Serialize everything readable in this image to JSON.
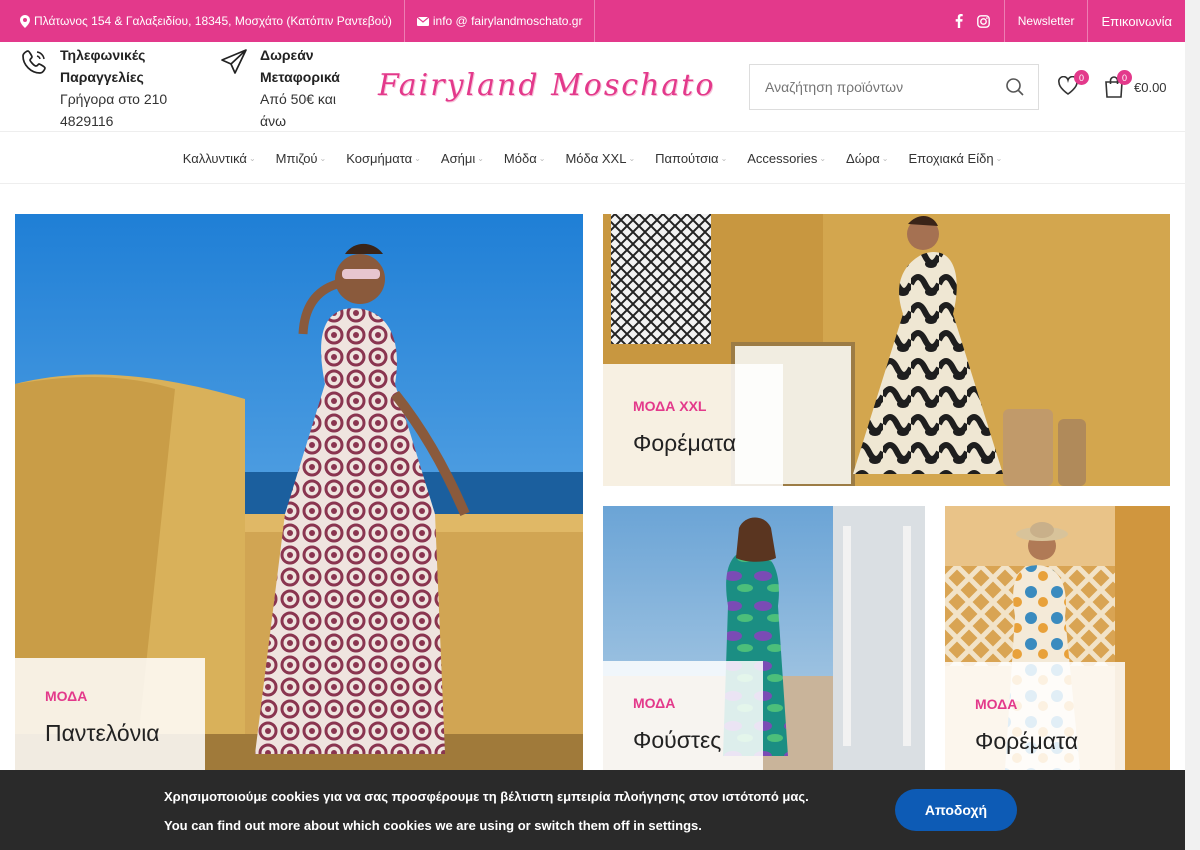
{
  "topbar": {
    "address": "Πλάτωνος 154 & Γαλαξειδίου, 18345, Μοσχάτο (Κατόπιν Ραντεβού)",
    "email": "info @ fairylandmoschato.gr",
    "newsletter": "Newsletter",
    "contact": "Επικοινωνία"
  },
  "header": {
    "phone_title_1": "Τηλεφωνικές",
    "phone_title_2": "Παραγγελίες",
    "phone_sub_1": "Γρήγορα στο 210",
    "phone_sub_2": "4829116",
    "ship_title_1": "Δωρεάν",
    "ship_title_2": "Μεταφορικά",
    "ship_sub_1": "Από 50€ και",
    "ship_sub_2": "άνω",
    "logo": "Fairyland Moschato",
    "search_placeholder": "Αναζήτηση προϊόντων",
    "wishlist_count": "0",
    "cart_count": "0",
    "cart_total": "€0.00"
  },
  "nav": {
    "items": [
      {
        "label": "Καλλυντικά"
      },
      {
        "label": "Μπιζού"
      },
      {
        "label": "Κοσμήματα"
      },
      {
        "label": "Ασήμι"
      },
      {
        "label": "Μόδα"
      },
      {
        "label": "Μόδα XXL"
      },
      {
        "label": "Παπούτσια"
      },
      {
        "label": "Accessories"
      },
      {
        "label": "Δώρα"
      },
      {
        "label": "Εποχιακά Είδη"
      }
    ]
  },
  "banners": [
    {
      "category": "ΜΟΔΑ",
      "title": "Παντελόνια"
    },
    {
      "category": "ΜΟΔΑ XXL",
      "title": "Φορέματα"
    },
    {
      "category": "ΜΟΔΑ",
      "title": "Φούστες"
    },
    {
      "category": "ΜΟΔΑ",
      "title": "Φορέματα"
    }
  ],
  "cookie": {
    "line1": "Χρησιμοποιούμε cookies για να σας προσφέρουμε τη βέλτιστη εμπειρία πλοήγησης στον ιστότοπό μας.",
    "line2": "You can find out more about which cookies we are using or switch them off in settings.",
    "accept": "Αποδοχή"
  },
  "colors": {
    "accent": "#e3398b",
    "cookie_bg": "#2a2a2a",
    "accept_bg": "#0d5bb5"
  }
}
